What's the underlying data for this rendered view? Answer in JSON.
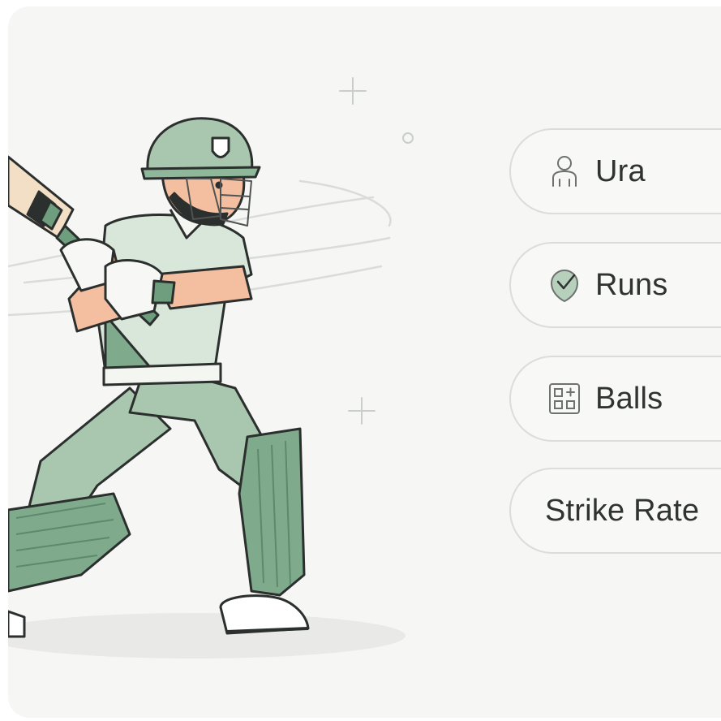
{
  "stat_pills": [
    {
      "label": "Ura",
      "icon": "person-icon"
    },
    {
      "label": "Runs",
      "icon": "shield-check-icon"
    },
    {
      "label": "Balls",
      "icon": "scorecard-icon"
    },
    {
      "label": "Strike Rate",
      "icon": ""
    }
  ],
  "colors": {
    "background": "#f6f6f5",
    "kit_green": "#a9c7ae",
    "kit_dark_green": "#6f9e7f",
    "outline": "#2b2f2d",
    "skin": "#f4bfa0",
    "pill_border": "#dcdcda",
    "text": "#2f3331"
  }
}
